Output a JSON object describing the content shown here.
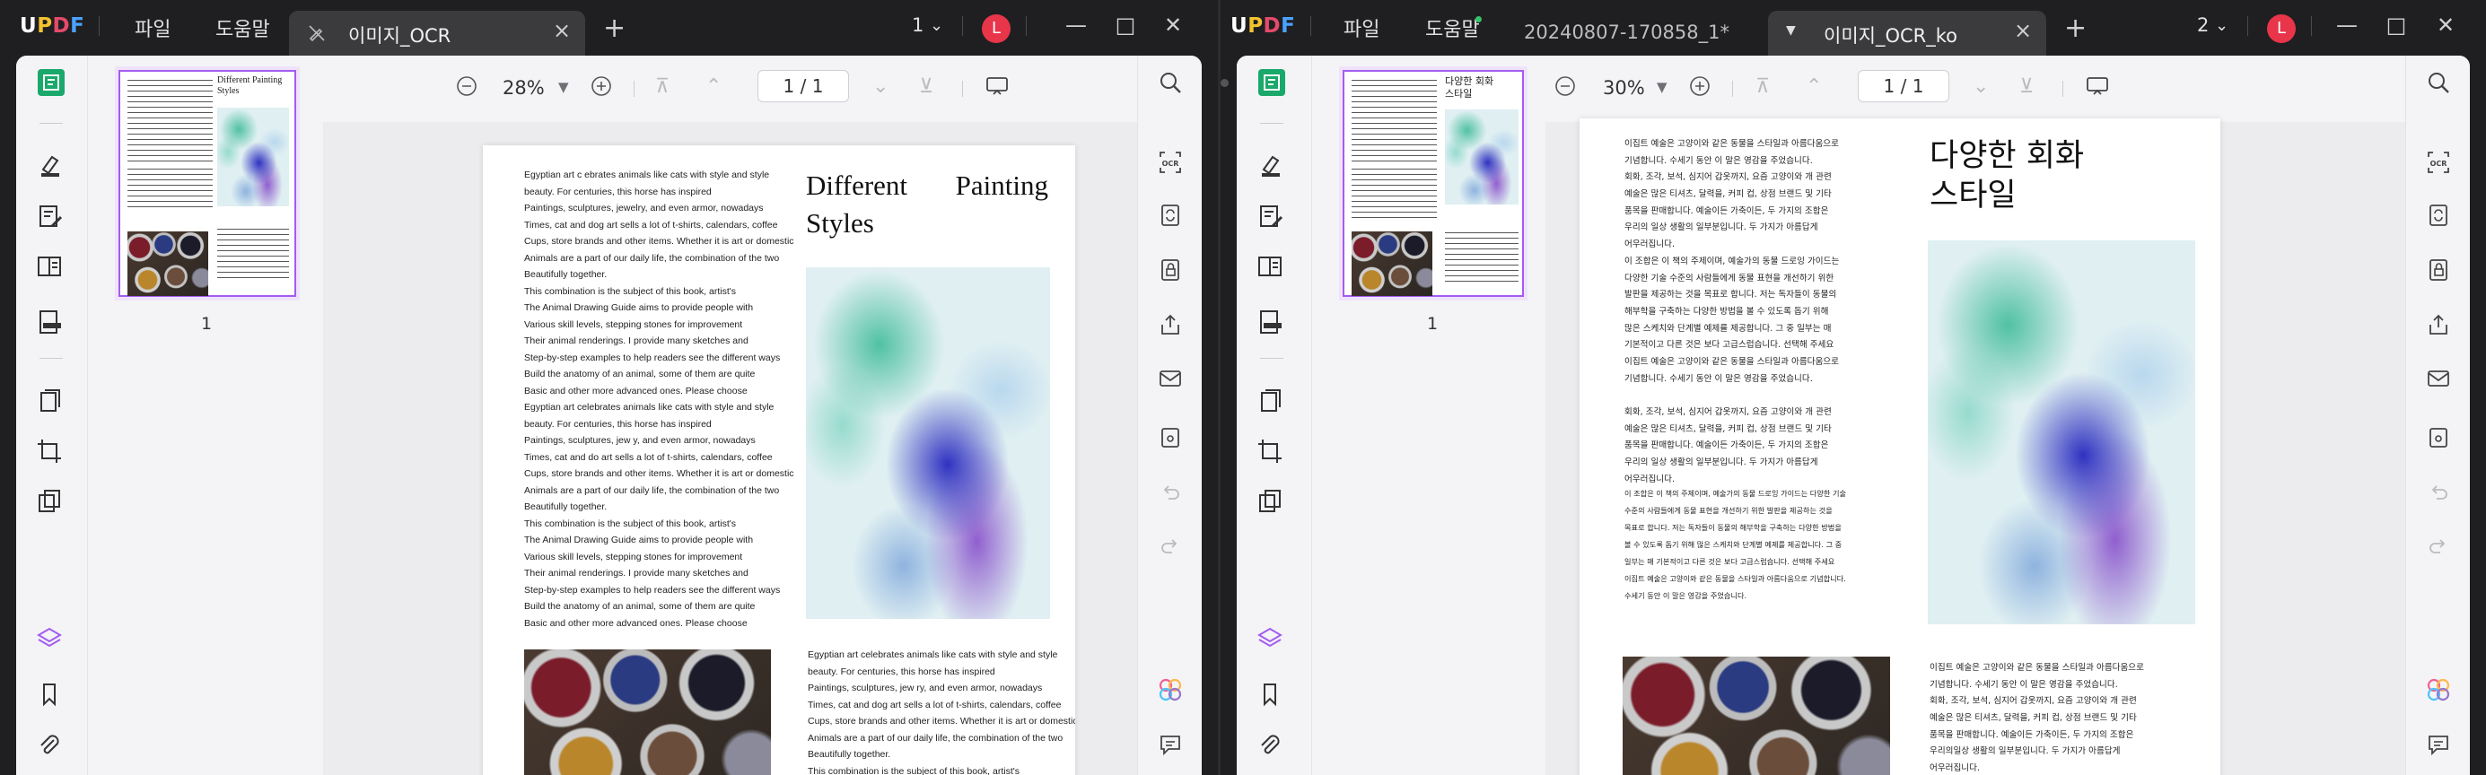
{
  "app": {
    "logo": "UPDF",
    "file_menu": "파일",
    "help_menu": "도움말"
  },
  "window1": {
    "tab_title": "이미지_OCR",
    "page_count_indicator": "1",
    "avatar_letter": "L",
    "zoom": "28%",
    "page_input": "1 / 1",
    "thumbnail_page_number": "1",
    "page": {
      "title_line1": "Different Painting",
      "title_line2": "Styles",
      "left_column": [
        "Egyptian art c ebrates animals like cats with style and style",
        "beauty. For centuries, this horse has inspired",
        "Paintings, sculptures, jewelry, and even armor, nowadays",
        "Times, cat and dog art sells a lot of t-shirts, calendars, coffee",
        "Cups, store brands and other items. Whether it is art or domestic",
        "Animals are a part of our daily life, the combination of the two",
        "Beautifully together.",
        "This combination is the subject of this book, artist's",
        "The Animal Drawing Guide aims to provide people with",
        "Various skill levels, stepping stones for improvement",
        "Their animal renderings. I provide many sketches and",
        "Step-by-step examples to help readers see the different ways",
        "Build the anatomy of an animal, some of them are quite",
        "Basic and other more advanced ones. Please choose",
        "Egyptian art celebrates animals like cats with style and style",
        "beauty. For centuries, this horse has inspired",
        "Paintings, sculptures, jew   y, and even armor, nowadays",
        "Times, cat and do  art sells a lot of t-shirts, calendars, coffee",
        "Cups, store brands and other items. Whether it is art or domestic",
        "Animals are a part of our daily life, the combination of the two",
        "Beautifully together.",
        "This combination is the subject of this book, artist's",
        "The Animal Drawing Guide aims to provide people with",
        "Various skill levels, stepping stones for improvement",
        "Their animal renderings. I provide many sketches and",
        "Step-by-step examples to help readers see the different ways",
        "Build the anatomy of an animal, some of them are quite",
        "Basic and other more advanced ones. Please choose"
      ],
      "bottom_right_column": [
        "Egyptian art celebrates animals like cats with style and style",
        "beauty. For centuries, this horse has inspired",
        "Paintings, sculptures, jew  ry, and even armor, nowadays",
        "Times, cat and dog art sells a lot of t-shirts, calendars, coffee",
        "Cups, store brands and other items. Whether it is art or domestic",
        "Animals are a part of our daily life, the combination of the two",
        "Beautifully together.",
        "This combination is the subject of this book, artist's"
      ]
    }
  },
  "window2": {
    "tab1_title": "20240807-170858_1*",
    "tab2_title": "이미지_OCR_ko",
    "page_count_indicator": "2",
    "avatar_letter": "L",
    "zoom": "30%",
    "page_input": "1 / 1",
    "thumbnail_page_number": "1",
    "page": {
      "title_line1": "다양한 회화",
      "title_line2": "스타일",
      "left_column": [
        "이집트 예술은 고양이와 같은 동물을 스타일과 아름다움으로",
        "  기념합니다. 수세기 동안 이 말은 영감을 주었습니다.",
        "회화, 조각, 보석, 심지어 갑옷까지, 요즘 고양이와 개 관련",
        "예술은 많은 티셔츠, 달력을, 커피 컵, 상점 브랜드 및 기타",
        "품목을 판매합니다. 예술이든 가축이든, 두 가지의 조합은",
        "우리의 일상 생활의 일부분입니다. 두 가지가 아름답게",
        "어우러집니다.",
        "이 조합은 이 책의 주제이며, 예술가의 동물 드로잉 가이드는",
        "  다양한 기술 수준의 사람들에게 동물 표현을 개선하기 위한",
        "발판을 제공하는 것을 목표로 합니다. 저는 독자들이 동물의",
        "해부학을 구축하는 다양한 방법을 볼 수 있도록 돕기 위해",
        "많은 스케치와 단계별 예제를 제공합니다. 그 중 일부는 매",
        "기본적이고 다른 것은 보다 고급스럽습니다. 선택해 주세요",
        "이집트 예술은 고양이와 같은 동물을 스타일과 아름다움으로",
        "  기념합니다. 수세기 동안 이 말은 영감을 주었습니다.",
        "",
        "회화, 조각, 보석, 심지어 갑옷까지, 요즘 고양이와 개 관련",
        "예술은 많은 티셔츠, 달력을, 커피 컵, 상점 브랜드 및 기타",
        "품목을 판매합니다. 예술이든 가축이든, 두 가지의 조합은",
        "우리의 일상 생활의 일부분입니다. 두 가지가 아름답게",
        "어우러집니다."
      ],
      "left_column_small": [
        "이 조합은 이 책의 주제이며, 예술가의 동물 드로잉 가이드는 다양한 기술",
        "수준의 사람들에게 동물 표현을 개선하기 위한 발판을 제공하는 것을",
        "목표로 합니다. 저는 독자들이 동물의 해부학을 구축하는 다양한 방법을",
        "볼 수 있도록 돕기 위해 많은 스케치와 단계별 예제를 제공합니다. 그 중",
        "일부는 매 기본적이고 다른 것은 보다 고급스럽습니다. 선택해 주세요",
        "이집트 예술은 고양이와 같은 동물을 스타일과 아름다움으로 기념합니다.",
        "수세기 동안 이 말은 영감을 주었습니다."
      ],
      "bottom_right_column": [
        "이집트 예술은 고양이와 같은 동물을 스타일과 아름다움으로",
        "  기념합니다. 수세기 동안 이 말은 영감을 주었습니다.",
        "회화, 조각, 보석, 심지어 갑옷까지, 요즘 고양이와 개 관련",
        "예술은 많은 티셔츠, 달력을, 커피 컵, 상점 브랜드 및 기타",
        "품목을 판매합니다. 예술이든 가축이든, 두 가지의 조합은",
        "우리의일상 생활의 일부분입니다. 두 가지가 아름답게",
        "어우러집니다."
      ]
    }
  },
  "colors": {
    "accent_purple": "#a35cf0",
    "avatar_red": "#e8354a",
    "active_icon_green": "#1aa86b"
  },
  "icons": {
    "left_sidebar": [
      "reader-icon",
      "highlighter-icon",
      "edit-text-icon",
      "form-icon",
      "fill-sign-icon",
      "organize-pages-icon",
      "crop-icon",
      "convert-icon",
      "layers-icon",
      "bookmark-icon",
      "attachment-icon"
    ],
    "right_sidebar": [
      "search-icon",
      "ocr-icon",
      "convert-icon",
      "protect-icon",
      "share-icon",
      "email-icon",
      "save-icon",
      "undo-icon",
      "redo-icon",
      "ai-assistant-icon",
      "comment-icon"
    ]
  }
}
